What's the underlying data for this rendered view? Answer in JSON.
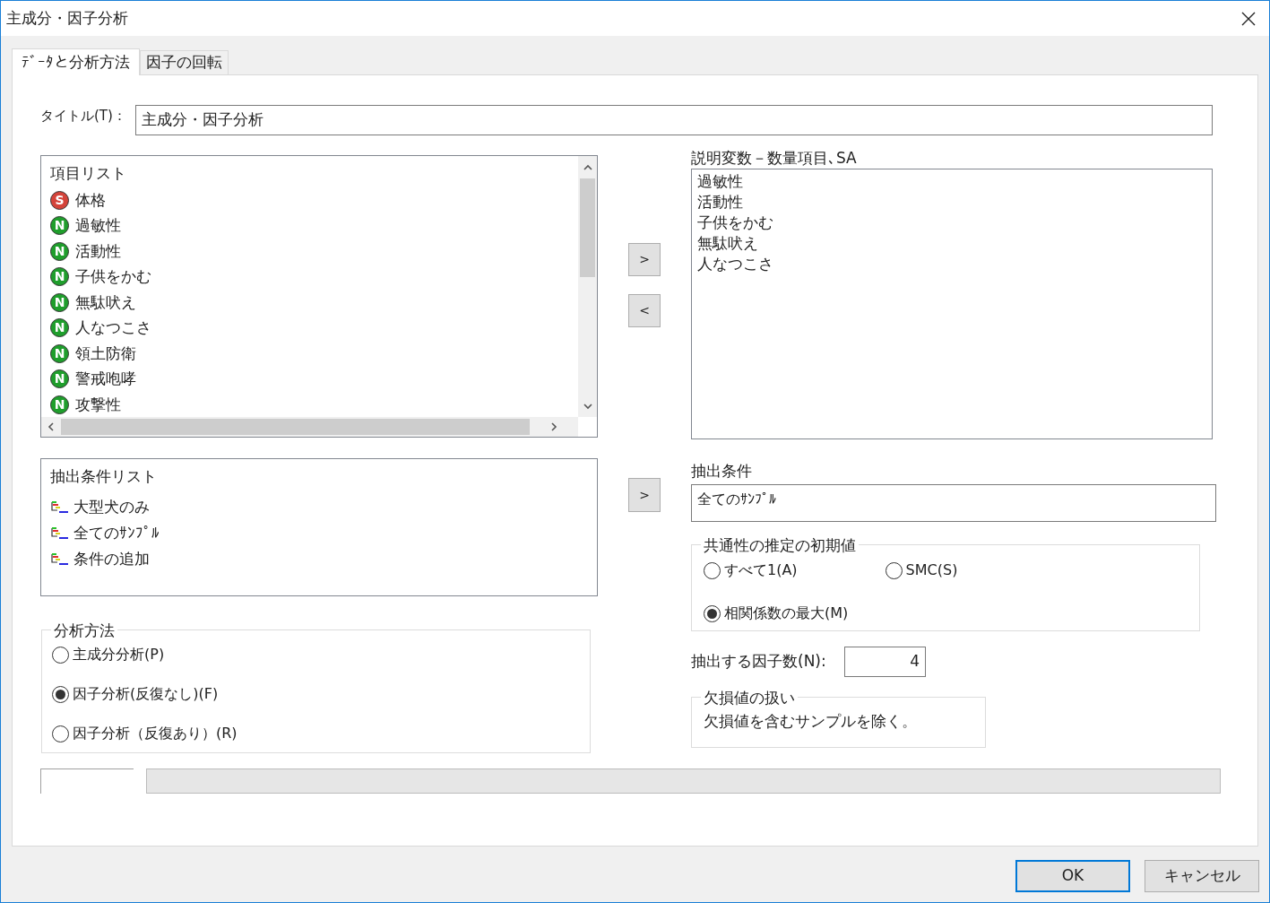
{
  "window": {
    "title": "主成分・因子分析"
  },
  "tabs": [
    {
      "label": "ﾃﾞｰﾀと分析方法",
      "selected": true
    },
    {
      "label": "因子の回転",
      "selected": false
    }
  ],
  "title_field": {
    "label": "タイトル(T)：",
    "value": "主成分・因子分析"
  },
  "item_list": {
    "header": "項目リスト",
    "items": [
      {
        "badge": "S",
        "color": "#d4433a",
        "label": "体格"
      },
      {
        "badge": "N",
        "color": "#1f9e2c",
        "label": "過敏性"
      },
      {
        "badge": "N",
        "color": "#1f9e2c",
        "label": "活動性"
      },
      {
        "badge": "N",
        "color": "#1f9e2c",
        "label": "子供をかむ"
      },
      {
        "badge": "N",
        "color": "#1f9e2c",
        "label": "無駄吠え"
      },
      {
        "badge": "N",
        "color": "#1f9e2c",
        "label": "人なつこさ"
      },
      {
        "badge": "N",
        "color": "#1f9e2c",
        "label": "領土防衛"
      },
      {
        "badge": "N",
        "color": "#1f9e2c",
        "label": "警戒咆哮"
      },
      {
        "badge": "N",
        "color": "#1f9e2c",
        "label": "攻撃性"
      }
    ]
  },
  "move_buttons": [
    ">",
    "<"
  ],
  "explanatory": {
    "label": "説明変数－数量項目､SA",
    "items": [
      "過敏性",
      "活動性",
      "子供をかむ",
      "無駄吠え",
      "人なつこさ"
    ]
  },
  "condition_list": {
    "header": "抽出条件リスト",
    "items": [
      "大型犬のみ",
      "全てのｻﾝﾌﾟﾙ",
      "条件の追加"
    ]
  },
  "condition_button": ">",
  "condition": {
    "label": "抽出条件",
    "value": "全てのｻﾝﾌﾟﾙ"
  },
  "method": {
    "legend": "分析方法",
    "options": [
      {
        "label": "主成分分析(P)",
        "selected": false
      },
      {
        "label": "因子分析(反復なし)(F)",
        "selected": true
      },
      {
        "label": "因子分析（反復あり）(R)",
        "selected": false
      }
    ]
  },
  "communality": {
    "legend": "共通性の推定の初期値",
    "options": [
      {
        "label": "すべて1(A)",
        "selected": false
      },
      {
        "label": "SMC(S)",
        "selected": false
      },
      {
        "label": "相関係数の最大(M)",
        "selected": true
      }
    ]
  },
  "factor_count": {
    "label": "抽出する因子数(N):",
    "value": "4"
  },
  "missing": {
    "legend": "欠損値の扱い",
    "text": "欠損値を含むサンプルを除く。"
  },
  "progress": {
    "level": 0
  },
  "buttons": [
    "OK",
    "キャンセル"
  ]
}
